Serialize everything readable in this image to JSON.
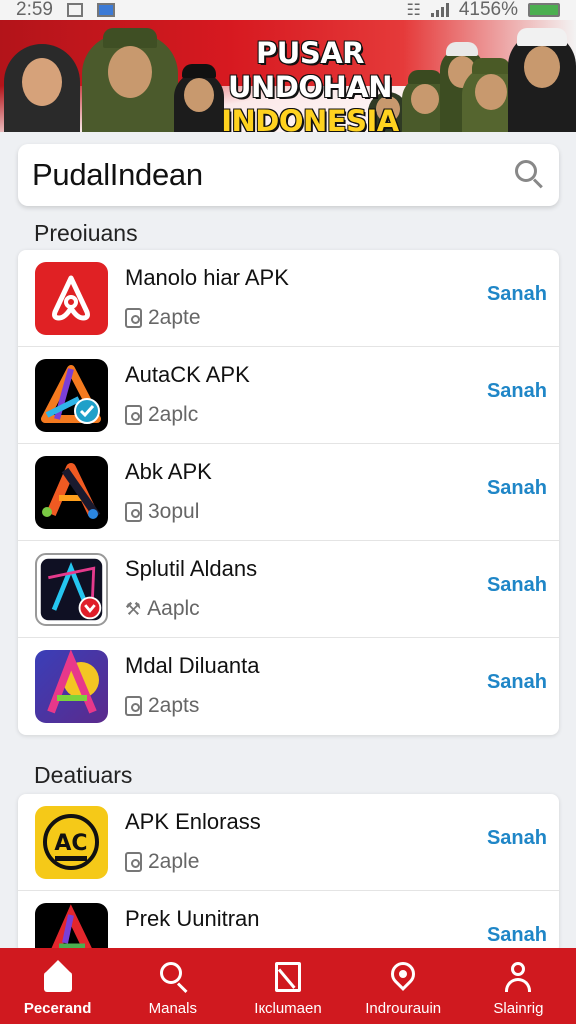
{
  "status_bar": {
    "time": "2:59",
    "battery": "4156%"
  },
  "banner": {
    "line1": "PUSAR UNDOHAN",
    "line2": "INDONESIA"
  },
  "search": {
    "value": "PudalIndean"
  },
  "sections": [
    {
      "title": "Preoiuans",
      "items": [
        {
          "name": "Manolo hiar APK",
          "meta": "2apte",
          "action": "Sanah",
          "icon": "airbnb-style-icon"
        },
        {
          "name": "AutaCK APK",
          "meta": "2aplc",
          "action": "Sanah",
          "icon": "triangle-logo-icon"
        },
        {
          "name": "Abk APK",
          "meta": "3opul",
          "action": "Sanah",
          "icon": "a-letter-logo-icon"
        },
        {
          "name": "Splutil Aldans",
          "meta": "Aaplc",
          "action": "Sanah",
          "icon": "neon-a-logo-icon"
        },
        {
          "name": "Mdal Diluanta",
          "meta": "2apts",
          "action": "Sanah",
          "icon": "gradient-a-logo-icon"
        }
      ]
    },
    {
      "title": "Deatiuars",
      "items": [
        {
          "name": "APK Enlorass",
          "meta": "2aple",
          "action": "Sanah",
          "icon": "ac-badge-icon"
        },
        {
          "name": "Prek Uunitran",
          "meta": "",
          "action": "Sanah",
          "icon": "colorful-a-logo-icon"
        }
      ]
    }
  ],
  "nav": [
    {
      "label": "Pecerand",
      "icon": "home-icon",
      "active": true
    },
    {
      "label": "Manals",
      "icon": "search-icon"
    },
    {
      "label": "Iкclumaen",
      "icon": "document-icon"
    },
    {
      "label": "Indrourauin",
      "icon": "location-pin-icon"
    },
    {
      "label": "Slainrig",
      "icon": "user-icon"
    }
  ],
  "colors": {
    "brand_red": "#d0191f",
    "action_blue": "#1f86c7",
    "banner_yellow": "#ffd21f"
  }
}
